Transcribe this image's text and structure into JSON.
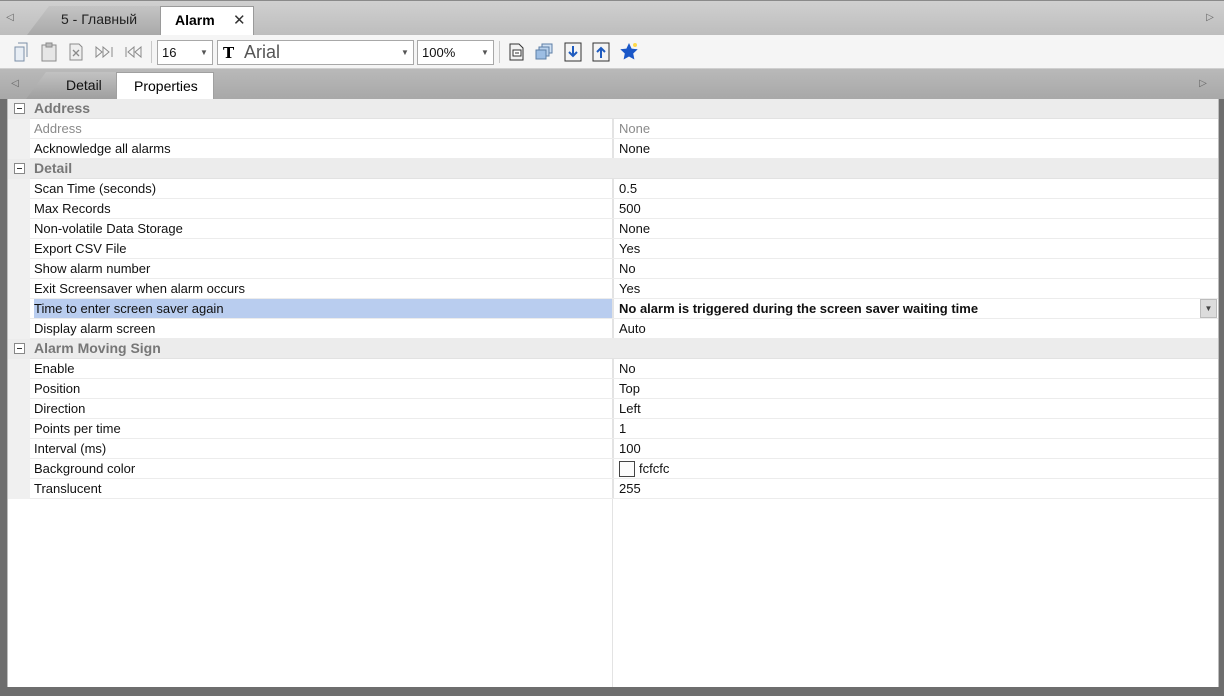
{
  "doc_tabs": [
    {
      "label": "5 - Главный",
      "active": false
    },
    {
      "label": "Alarm",
      "active": true
    }
  ],
  "toolbar": {
    "font_size": "16",
    "font_name": "Arial",
    "font_glyph": "T",
    "zoom": "100%"
  },
  "panel_tabs": [
    {
      "label": "Detail",
      "active": false
    },
    {
      "label": "Properties",
      "active": true
    }
  ],
  "grid": {
    "categories": [
      {
        "label": "Address",
        "rows": [
          {
            "name": "Address",
            "value": "None",
            "disabled": true
          },
          {
            "name": "Acknowledge all alarms",
            "value": "None"
          }
        ]
      },
      {
        "label": "Detail",
        "rows": [
          {
            "name": "Scan Time (seconds)",
            "value": "0.5"
          },
          {
            "name": "Max Records",
            "value": "500"
          },
          {
            "name": "Non-volatile Data Storage",
            "value": "None"
          },
          {
            "name": "Export CSV File",
            "value": "Yes"
          },
          {
            "name": "Show alarm number",
            "value": "No"
          },
          {
            "name": "Exit Screensaver when alarm occurs",
            "value": "Yes"
          },
          {
            "name": "Time to enter screen saver again",
            "value": "No alarm is triggered during the screen saver waiting time",
            "selected": true
          },
          {
            "name": "Display alarm screen",
            "value": "Auto"
          }
        ]
      },
      {
        "label": "Alarm Moving Sign",
        "rows": [
          {
            "name": "Enable",
            "value": "No"
          },
          {
            "name": "Position",
            "value": "Top"
          },
          {
            "name": "Direction",
            "value": "Left"
          },
          {
            "name": "Points per time",
            "value": "1"
          },
          {
            "name": "Interval (ms)",
            "value": "100"
          },
          {
            "name": "Background color",
            "value": "fcfcfc",
            "swatch": "#fcfcfc"
          },
          {
            "name": "Translucent",
            "value": "255"
          }
        ]
      }
    ]
  },
  "colors": {
    "selection": "#b9cdef",
    "accent_blue": "#1e5bbf",
    "star": "#1a57c8"
  },
  "icons": [
    "new-page-icon",
    "paste-icon",
    "delete-icon",
    "next-page-icon",
    "prev-page-icon",
    "font-icon",
    "export-icon",
    "layers-icon",
    "download-icon",
    "upload-icon",
    "star-icon"
  ]
}
